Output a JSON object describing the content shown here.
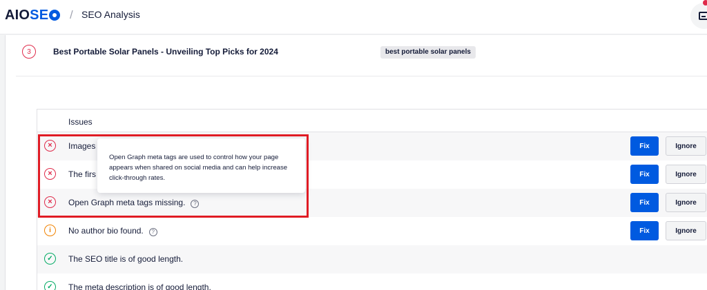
{
  "header": {
    "logo_left": "AIO",
    "logo_right": "SE",
    "separator": "/",
    "page_title": "SEO Analysis",
    "notification_color": "#df2a4a"
  },
  "post": {
    "score": "3",
    "title": "Best Portable Solar Panels - Unveiling Top Picks for 2024",
    "keyphrase": "best portable solar panels"
  },
  "issues": {
    "header": "Issues",
    "fix_label": "Fix",
    "ignore_label": "Ignore",
    "help_glyph": "?",
    "rows": [
      {
        "status": "error",
        "icon": "×",
        "text": "Images",
        "has_help": false,
        "actions": true
      },
      {
        "status": "error",
        "icon": "×",
        "text": "The firs",
        "has_help": false,
        "actions": true
      },
      {
        "status": "error",
        "icon": "×",
        "text": "Open Graph meta tags missing.",
        "has_help": true,
        "actions": true
      },
      {
        "status": "warning",
        "icon": "i",
        "text": "No author bio found.",
        "has_help": true,
        "actions": true
      },
      {
        "status": "ok",
        "icon": "✓",
        "text": "The SEO title is of good length.",
        "has_help": false,
        "actions": false
      },
      {
        "status": "ok",
        "icon": "✓",
        "text": "The meta description is of good length.",
        "has_help": false,
        "actions": false
      }
    ]
  },
  "tooltip": {
    "text": "Open Graph meta tags are used to control how your page appears when shared on social media and can help increase click-through rates."
  },
  "colors": {
    "brand_blue": "#005ae0",
    "error_red": "#df2a4a",
    "warning_orange": "#f18200",
    "success_green": "#00aa63",
    "highlight_red": "#e01b24"
  }
}
